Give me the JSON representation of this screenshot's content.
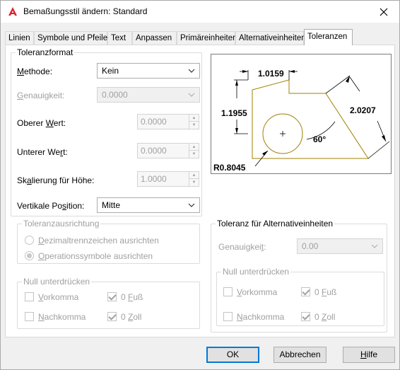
{
  "window": {
    "title": "Bemaßungsstil ändern: Standard"
  },
  "tabs": [
    {
      "label": "Linien"
    },
    {
      "label": "Symbole und Pfeile"
    },
    {
      "label": "Text"
    },
    {
      "label": "Anpassen"
    },
    {
      "label": "Primäreinheiten"
    },
    {
      "label": "Alternativeinheiten"
    },
    {
      "label": "Toleranzen"
    }
  ],
  "tolerance_format": {
    "group_label": "Toleranzformat",
    "method": {
      "label_pre": "",
      "label_u": "M",
      "label_post": "ethode:",
      "value": "Kein"
    },
    "precision": {
      "label_pre": "",
      "label_u": "G",
      "label_post": "enauigkeit:",
      "value": "0.0000"
    },
    "upper": {
      "label_pre": "Oberer ",
      "label_u": "W",
      "label_post": "ert:",
      "value": "0.0000"
    },
    "lower": {
      "label_pre": "Unterer We",
      "label_u": "r",
      "label_post": "t:",
      "value": "0.0000"
    },
    "scale": {
      "label_pre": "Sk",
      "label_u": "a",
      "label_post": "lierung für Höhe:",
      "value": "1.0000"
    },
    "vertical": {
      "label_pre": "Vertikale Po",
      "label_u": "s",
      "label_post": "ition:",
      "value": "Mitte"
    }
  },
  "tolerance_alignment": {
    "group_label": "Toleranzausrichtung",
    "opt1": {
      "label_pre": "",
      "label_u": "D",
      "label_post": "ezimaltrennzeichen ausrichten"
    },
    "opt2": {
      "label_pre": "",
      "label_u": "O",
      "label_post": "perationssymbole ausrichten"
    }
  },
  "zero_left": {
    "group_label": "Null unterdrücken",
    "leading": {
      "label_pre": "",
      "label_u": "V",
      "label_post": "orkomma"
    },
    "trailing": {
      "label_pre": "",
      "label_u": "N",
      "label_post": "achkomma"
    },
    "feet": {
      "label_pre": "0 ",
      "label_u": "F",
      "label_post": "uß"
    },
    "inches": {
      "label_pre": "0 ",
      "label_u": "Z",
      "label_post": "oll"
    }
  },
  "alt_tolerance": {
    "group_label": "Toleranz für Alternativeinheiten",
    "precision": {
      "label_pre": "Genauigkei",
      "label_u": "t",
      "label_post": ":",
      "value": "0.00"
    }
  },
  "zero_right": {
    "group_label": "Null unterdrücken",
    "leading": {
      "label_pre": "",
      "label_u": "V",
      "label_post": "orkomma"
    },
    "trailing": {
      "label_pre": "",
      "label_u": "N",
      "label_post": "achkomma"
    },
    "feet": {
      "label_pre": "0 ",
      "label_u": "F",
      "label_post": "uß"
    },
    "inches": {
      "label_pre": "0 ",
      "label_u": "Z",
      "label_post": "oll"
    }
  },
  "preview": {
    "dim_top": "1.0159",
    "dim_left": "1.1955",
    "dim_right": "2.0207",
    "angle": "60°",
    "radius": "R0.8045",
    "line_color": "#a08000"
  },
  "buttons": {
    "ok": "OK",
    "cancel": "Abbrechen",
    "help_pre": "",
    "help_u": "H",
    "help_post": "ilfe"
  },
  "colors": {
    "accent": "#0078d7",
    "app_icon": "#d9232e"
  }
}
